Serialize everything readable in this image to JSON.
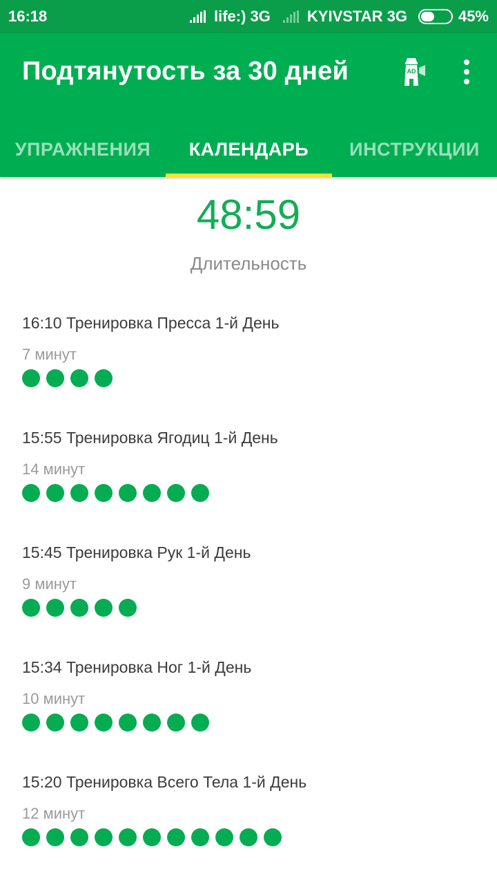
{
  "status_bar": {
    "time": "16:18",
    "carrier1": "life:) 3G",
    "carrier2": "KYIVSTAR 3G",
    "battery_percent": "45%",
    "battery_level": 0.45
  },
  "app_bar": {
    "title": "Подтянутость за 30 дней",
    "icons": [
      "ad-lighthouse-icon",
      "more-vert-icon"
    ]
  },
  "tabs": [
    {
      "label": "УПРАЖНЕНИЯ",
      "active": false
    },
    {
      "label": "КАЛЕНДАРЬ",
      "active": true
    },
    {
      "label": "ИНСТРУКЦИИ",
      "active": false
    }
  ],
  "summary": {
    "duration_value": "48:59",
    "duration_label": "Длительность"
  },
  "workouts": [
    {
      "title": "16:10 Тренировка Пресса 1-й День",
      "duration": "7 минут",
      "dots": 4
    },
    {
      "title": "15:55 Тренировка Ягодиц 1-й День",
      "duration": "14 минут",
      "dots": 8
    },
    {
      "title": "15:45 Тренировка Рук 1-й День",
      "duration": "9 минут",
      "dots": 5
    },
    {
      "title": "15:34 Тренировка Ног 1-й День",
      "duration": "10 минут",
      "dots": 8
    },
    {
      "title": "15:20 Тренировка Всего Тела 1-й День",
      "duration": "12 минут",
      "dots": 11
    }
  ],
  "colors": {
    "status_bar": "#0a9e4a",
    "app_bar": "#00ae52",
    "accent_green": "#05ac52",
    "tab_indicator": "#ffe22b"
  }
}
